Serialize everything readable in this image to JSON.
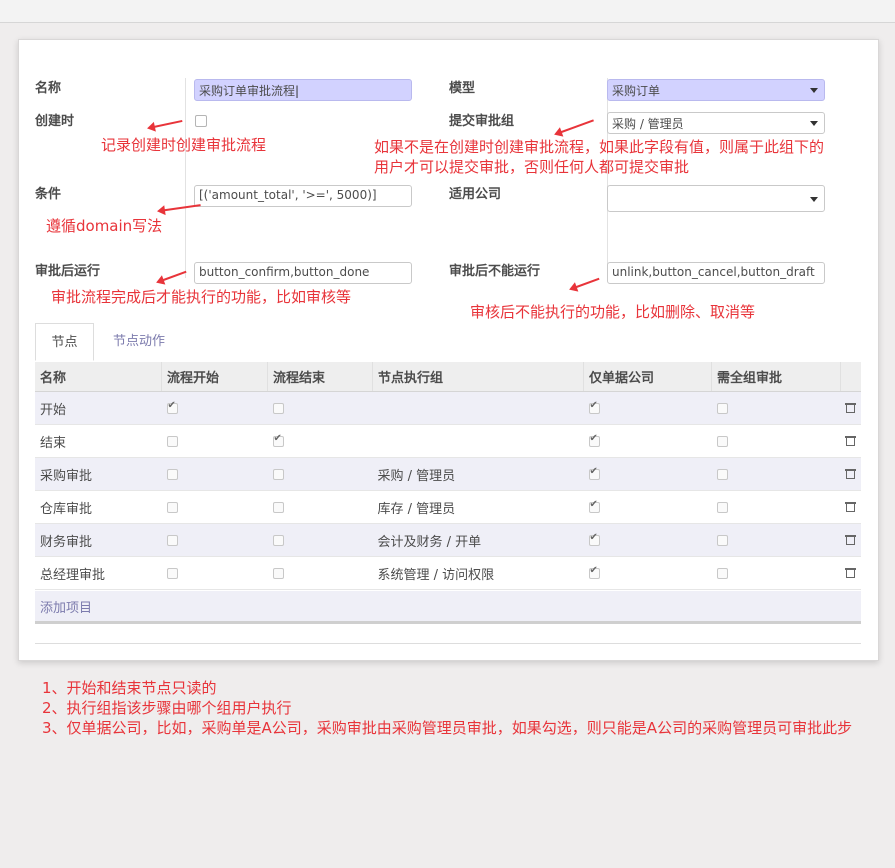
{
  "form": {
    "name_label": "名称",
    "name_value": "采购订单审批流程",
    "on_create_label": "创建时",
    "condition_label": "条件",
    "condition_value": "[('amount_total', '>=', 5000)]",
    "after_label": "审批后运行",
    "after_value": "button_confirm,button_done",
    "model_label": "模型",
    "model_value": "采购订单",
    "submit_group_label": "提交审批组",
    "submit_group_value": "采购 / 管理员",
    "company_label": "适用公司",
    "company_value": "",
    "cannot_label": "审批后不能运行",
    "cannot_value": "unlink,button_cancel,button_draft"
  },
  "annotations": {
    "on_create": "记录创建时创建审批流程",
    "submit_group_line1": "如果不是在创建时创建审批流程，如果此字段有值，则属于此组下的",
    "submit_group_line2": "用户才可以提交审批，否则任何人都可提交审批",
    "condition": "遵循domain写法",
    "after": "审批流程完成后才能执行的功能，比如审核等",
    "cannot": "审核后不能执行的功能，比如删除、取消等"
  },
  "tabs": [
    {
      "label": "节点",
      "active": true
    },
    {
      "label": "节点动作",
      "active": false
    }
  ],
  "table": {
    "columns": [
      "名称",
      "流程开始",
      "流程结束",
      "节点执行组",
      "仅单据公司",
      "需全组审批"
    ],
    "rows": [
      {
        "name": "开始",
        "start": true,
        "end": false,
        "group": "",
        "company_only": true,
        "all_group": false
      },
      {
        "name": "结束",
        "start": false,
        "end": true,
        "group": "",
        "company_only": true,
        "all_group": false
      },
      {
        "name": "采购审批",
        "start": false,
        "end": false,
        "group": "采购 / 管理员",
        "company_only": true,
        "all_group": false
      },
      {
        "name": "仓库审批",
        "start": false,
        "end": false,
        "group": "库存 / 管理员",
        "company_only": true,
        "all_group": false
      },
      {
        "name": "财务审批",
        "start": false,
        "end": false,
        "group": "会计及财务 / 开单",
        "company_only": true,
        "all_group": false
      },
      {
        "name": "总经理审批",
        "start": false,
        "end": false,
        "group": "系统管理 / 访问权限",
        "company_only": true,
        "all_group": false
      }
    ],
    "add_item": "添加项目"
  },
  "notes": [
    "1、开始和结束节点只读的",
    "2、执行组指该步骤由哪个组用户执行",
    "3、仅单据公司，比如，采购单是A公司，采购审批由采购管理员审批，如果勾选，则只能是A公司的采购管理员可审批此步"
  ],
  "colors": {
    "annotation": "#e8343a",
    "highlight": "#d2d2ff",
    "link": "#7c7bad"
  }
}
